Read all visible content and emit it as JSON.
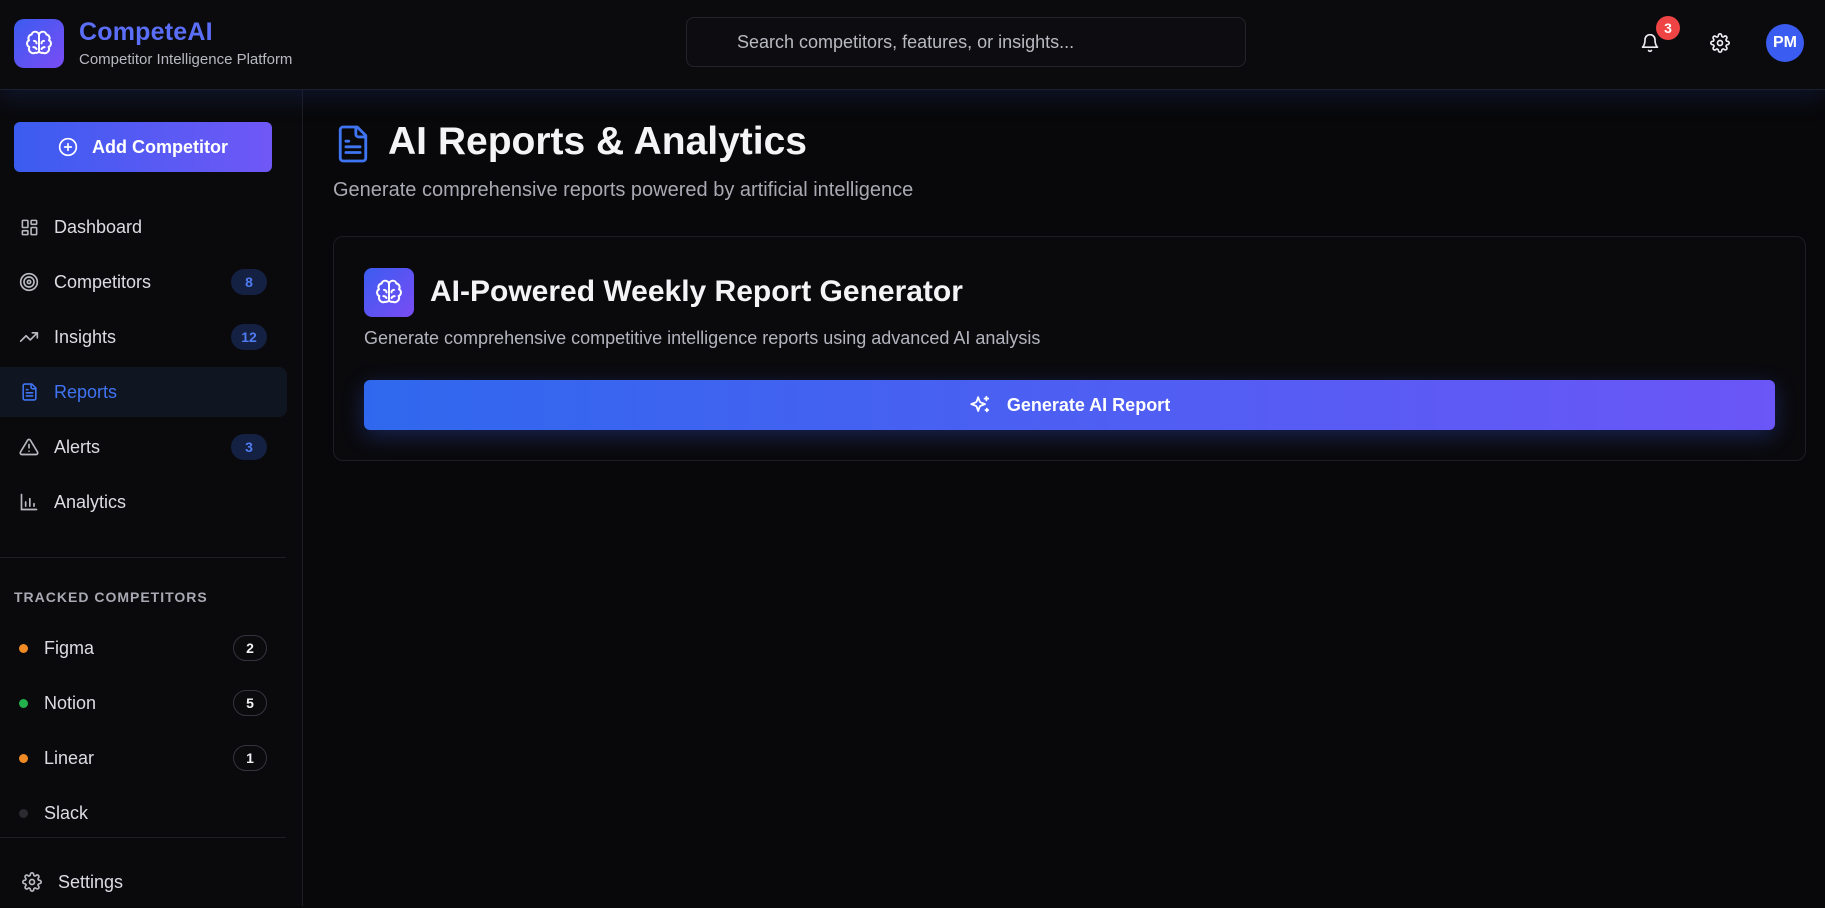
{
  "app": {
    "name": "CompeteAI",
    "tagline": "Competitor Intelligence Platform"
  },
  "header": {
    "search_placeholder": "Search competitors, features, or insights...",
    "notification_count": "3",
    "avatar_initials": "PM"
  },
  "sidebar": {
    "add_button_label": "Add Competitor",
    "nav": [
      {
        "label": "Dashboard",
        "icon": "grid-icon"
      },
      {
        "label": "Competitors",
        "icon": "target-icon",
        "count": "8"
      },
      {
        "label": "Insights",
        "icon": "trending-up-icon",
        "count": "12"
      },
      {
        "label": "Reports",
        "icon": "file-text-icon",
        "active": true
      },
      {
        "label": "Alerts",
        "icon": "alert-triangle-icon",
        "count": "3"
      },
      {
        "label": "Analytics",
        "icon": "bar-chart-icon"
      }
    ],
    "tracked_title": "TRACKED COMPETITORS",
    "tracked": [
      {
        "name": "Figma",
        "count": "2",
        "color": "#f08a24"
      },
      {
        "name": "Notion",
        "count": "5",
        "color": "#22b14c"
      },
      {
        "name": "Linear",
        "count": "1",
        "color": "#f08a24"
      },
      {
        "name": "Slack",
        "color": "#2a2a30"
      }
    ],
    "settings_label": "Settings"
  },
  "main": {
    "title": "AI Reports & Analytics",
    "subtitle": "Generate comprehensive reports powered by artificial intelligence",
    "card": {
      "title": "AI-Powered Weekly Report Generator",
      "description": "Generate comprehensive competitive intelligence reports using advanced AI analysis",
      "button_label": "Generate AI Report"
    }
  },
  "colors": {
    "accent": "#3b5cf0",
    "accent_purple": "#7a4cf5",
    "badge_red": "#ef4444"
  }
}
